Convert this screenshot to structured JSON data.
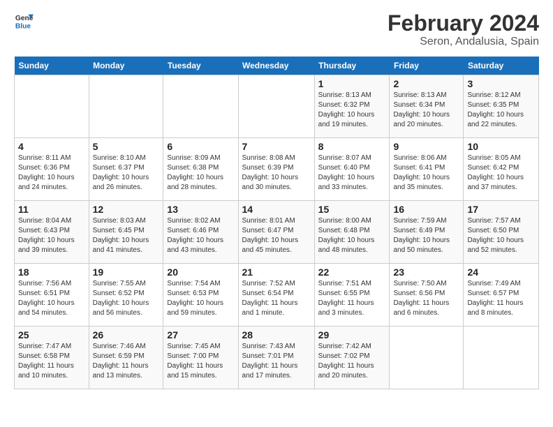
{
  "logo": {
    "line1": "General",
    "line2": "Blue"
  },
  "title": "February 2024",
  "subtitle": "Seron, Andalusia, Spain",
  "days_of_week": [
    "Sunday",
    "Monday",
    "Tuesday",
    "Wednesday",
    "Thursday",
    "Friday",
    "Saturday"
  ],
  "weeks": [
    [
      {
        "day": "",
        "info": ""
      },
      {
        "day": "",
        "info": ""
      },
      {
        "day": "",
        "info": ""
      },
      {
        "day": "",
        "info": ""
      },
      {
        "day": "1",
        "info": "Sunrise: 8:13 AM\nSunset: 6:32 PM\nDaylight: 10 hours and 19 minutes."
      },
      {
        "day": "2",
        "info": "Sunrise: 8:13 AM\nSunset: 6:34 PM\nDaylight: 10 hours and 20 minutes."
      },
      {
        "day": "3",
        "info": "Sunrise: 8:12 AM\nSunset: 6:35 PM\nDaylight: 10 hours and 22 minutes."
      }
    ],
    [
      {
        "day": "4",
        "info": "Sunrise: 8:11 AM\nSunset: 6:36 PM\nDaylight: 10 hours and 24 minutes."
      },
      {
        "day": "5",
        "info": "Sunrise: 8:10 AM\nSunset: 6:37 PM\nDaylight: 10 hours and 26 minutes."
      },
      {
        "day": "6",
        "info": "Sunrise: 8:09 AM\nSunset: 6:38 PM\nDaylight: 10 hours and 28 minutes."
      },
      {
        "day": "7",
        "info": "Sunrise: 8:08 AM\nSunset: 6:39 PM\nDaylight: 10 hours and 30 minutes."
      },
      {
        "day": "8",
        "info": "Sunrise: 8:07 AM\nSunset: 6:40 PM\nDaylight: 10 hours and 33 minutes."
      },
      {
        "day": "9",
        "info": "Sunrise: 8:06 AM\nSunset: 6:41 PM\nDaylight: 10 hours and 35 minutes."
      },
      {
        "day": "10",
        "info": "Sunrise: 8:05 AM\nSunset: 6:42 PM\nDaylight: 10 hours and 37 minutes."
      }
    ],
    [
      {
        "day": "11",
        "info": "Sunrise: 8:04 AM\nSunset: 6:43 PM\nDaylight: 10 hours and 39 minutes."
      },
      {
        "day": "12",
        "info": "Sunrise: 8:03 AM\nSunset: 6:45 PM\nDaylight: 10 hours and 41 minutes."
      },
      {
        "day": "13",
        "info": "Sunrise: 8:02 AM\nSunset: 6:46 PM\nDaylight: 10 hours and 43 minutes."
      },
      {
        "day": "14",
        "info": "Sunrise: 8:01 AM\nSunset: 6:47 PM\nDaylight: 10 hours and 45 minutes."
      },
      {
        "day": "15",
        "info": "Sunrise: 8:00 AM\nSunset: 6:48 PM\nDaylight: 10 hours and 48 minutes."
      },
      {
        "day": "16",
        "info": "Sunrise: 7:59 AM\nSunset: 6:49 PM\nDaylight: 10 hours and 50 minutes."
      },
      {
        "day": "17",
        "info": "Sunrise: 7:57 AM\nSunset: 6:50 PM\nDaylight: 10 hours and 52 minutes."
      }
    ],
    [
      {
        "day": "18",
        "info": "Sunrise: 7:56 AM\nSunset: 6:51 PM\nDaylight: 10 hours and 54 minutes."
      },
      {
        "day": "19",
        "info": "Sunrise: 7:55 AM\nSunset: 6:52 PM\nDaylight: 10 hours and 56 minutes."
      },
      {
        "day": "20",
        "info": "Sunrise: 7:54 AM\nSunset: 6:53 PM\nDaylight: 10 hours and 59 minutes."
      },
      {
        "day": "21",
        "info": "Sunrise: 7:52 AM\nSunset: 6:54 PM\nDaylight: 11 hours and 1 minute."
      },
      {
        "day": "22",
        "info": "Sunrise: 7:51 AM\nSunset: 6:55 PM\nDaylight: 11 hours and 3 minutes."
      },
      {
        "day": "23",
        "info": "Sunrise: 7:50 AM\nSunset: 6:56 PM\nDaylight: 11 hours and 6 minutes."
      },
      {
        "day": "24",
        "info": "Sunrise: 7:49 AM\nSunset: 6:57 PM\nDaylight: 11 hours and 8 minutes."
      }
    ],
    [
      {
        "day": "25",
        "info": "Sunrise: 7:47 AM\nSunset: 6:58 PM\nDaylight: 11 hours and 10 minutes."
      },
      {
        "day": "26",
        "info": "Sunrise: 7:46 AM\nSunset: 6:59 PM\nDaylight: 11 hours and 13 minutes."
      },
      {
        "day": "27",
        "info": "Sunrise: 7:45 AM\nSunset: 7:00 PM\nDaylight: 11 hours and 15 minutes."
      },
      {
        "day": "28",
        "info": "Sunrise: 7:43 AM\nSunset: 7:01 PM\nDaylight: 11 hours and 17 minutes."
      },
      {
        "day": "29",
        "info": "Sunrise: 7:42 AM\nSunset: 7:02 PM\nDaylight: 11 hours and 20 minutes."
      },
      {
        "day": "",
        "info": ""
      },
      {
        "day": "",
        "info": ""
      }
    ]
  ]
}
